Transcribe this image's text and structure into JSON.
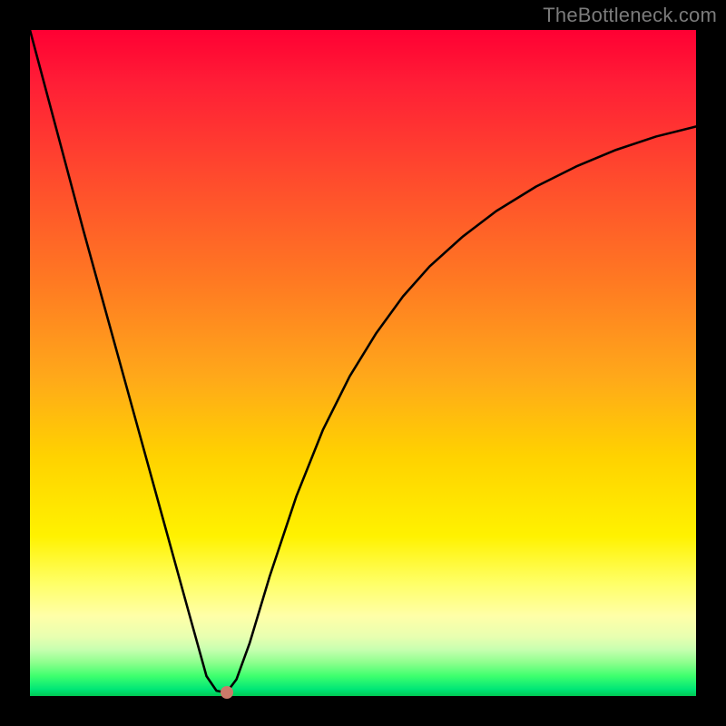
{
  "watermark": {
    "text": "TheBottleneck.com"
  },
  "colors": {
    "frame": "#000000",
    "gradient_top": "#ff0033",
    "gradient_mid": "#ffd200",
    "gradient_bottom": "#00c853",
    "curve": "#000000",
    "dot": "#cc7a6a",
    "watermark": "#7b7b7b"
  },
  "chart_data": {
    "type": "line",
    "title": "",
    "xlabel": "",
    "ylabel": "",
    "xlim": [
      0,
      100
    ],
    "ylim": [
      0,
      100
    ],
    "grid": false,
    "legend": false,
    "series": [
      {
        "name": "curve",
        "x": [
          0,
          4,
          8,
          12,
          16,
          20,
          24,
          26.5,
          28,
          29.5,
          31,
          33,
          36,
          40,
          44,
          48,
          52,
          56,
          60,
          65,
          70,
          76,
          82,
          88,
          94,
          100
        ],
        "y": [
          100,
          85,
          70,
          55.5,
          41,
          26.5,
          12,
          3,
          0.8,
          0.5,
          2.5,
          8,
          18,
          30,
          40,
          48,
          54.5,
          60,
          64.5,
          69,
          72.8,
          76.5,
          79.5,
          82,
          84,
          85.5
        ]
      }
    ],
    "marker": {
      "x": 29.5,
      "y": 0.5
    },
    "description": "V-shaped black curve on a square with a vertical red-to-green gradient background; minimum near x≈29–30, rising asymptotically toward the right."
  }
}
